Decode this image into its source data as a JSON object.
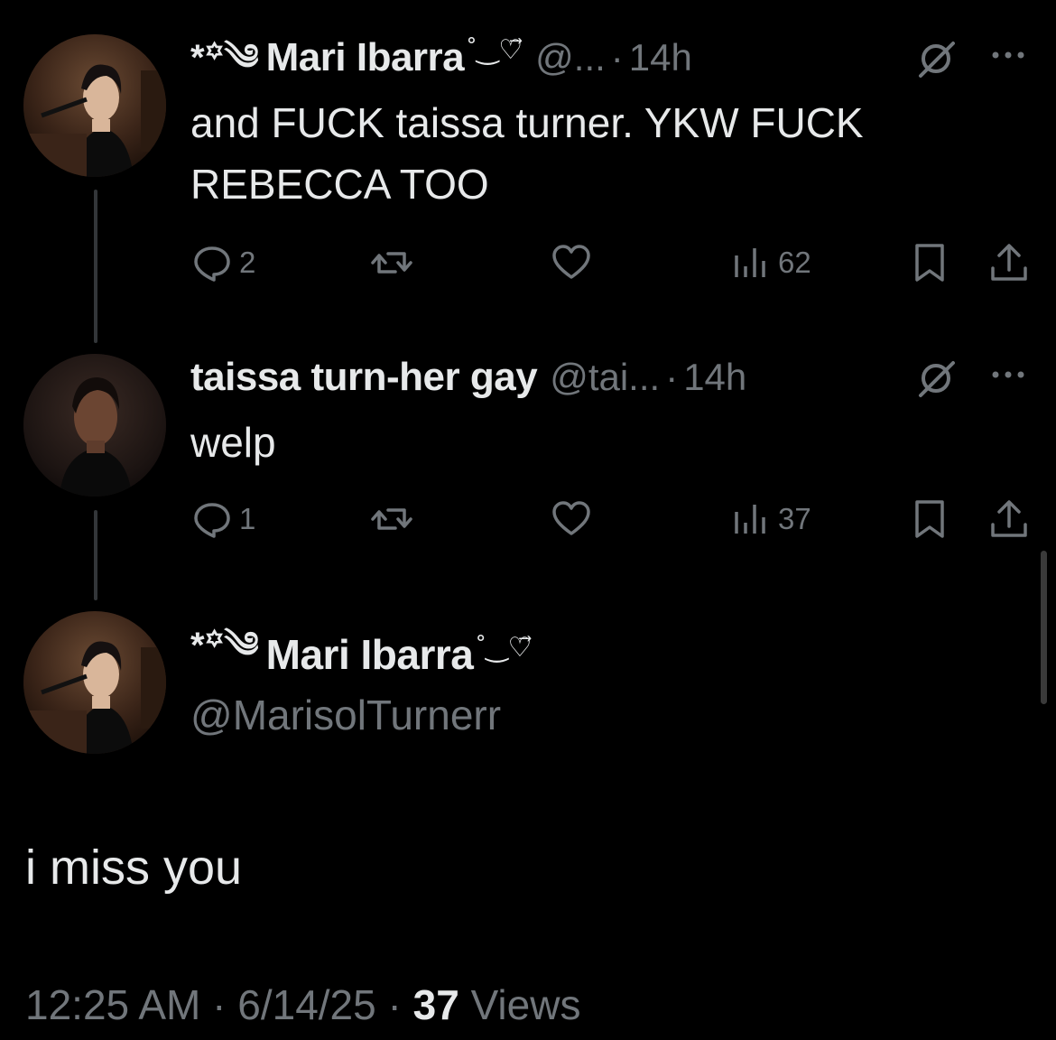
{
  "tweets": [
    {
      "display_name": "Mari Ibarra",
      "name_prefix": "*꙳༄",
      "name_suffix": "˚‿♡⃗",
      "handle": "@...",
      "separator": "·",
      "time": "14h",
      "text": "and FUCK taissa turner. YKW FUCK\nREBECCA TOO",
      "replies": "2",
      "reposts": "",
      "likes": "",
      "views": "62"
    },
    {
      "display_name": "taissa turn-her gay",
      "handle": "@tai...",
      "separator": "·",
      "time": "14h",
      "text": "welp",
      "replies": "1",
      "reposts": "",
      "likes": "",
      "views": "37"
    }
  ],
  "main_tweet": {
    "display_name": "Mari Ibarra",
    "name_prefix": "*꙳༄",
    "name_suffix": "˚‿♡⃗",
    "handle": "@MarisolTurnerr",
    "text": "i miss you",
    "time": "12:25 AM",
    "separator": "·",
    "date": "6/14/25",
    "views_count": "37",
    "views_label": "Views"
  },
  "icons": {
    "reply": "reply-icon",
    "repost": "repost-icon",
    "like": "heart-icon",
    "views": "views-chart-icon",
    "bookmark": "bookmark-icon",
    "share": "share-icon",
    "grok": "grok-icon",
    "more": "more-icon"
  },
  "colors": {
    "background": "#000000",
    "primary_text": "#e7e9ea",
    "secondary_text": "#71767b",
    "thread_line": "#333639"
  }
}
